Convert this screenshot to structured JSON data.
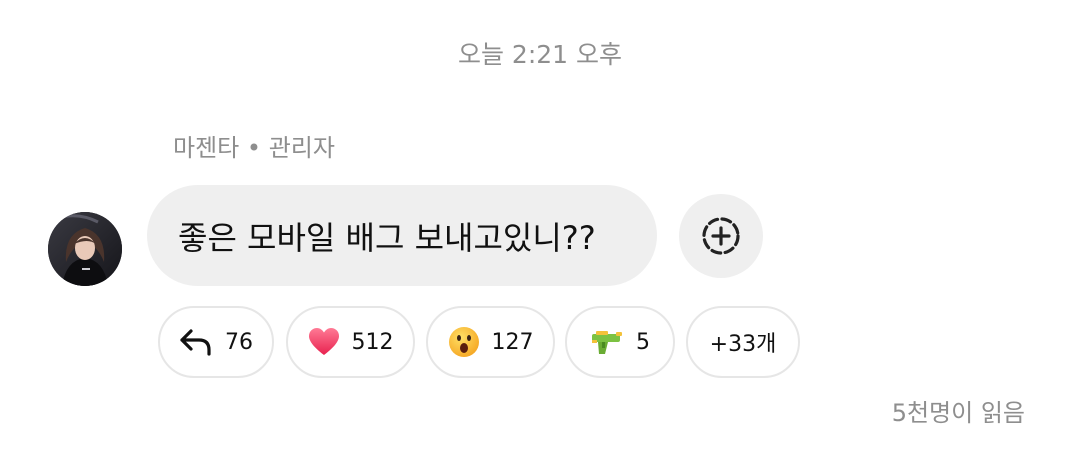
{
  "timestamp": "오늘 2:21 오후",
  "message": {
    "sender_name": "마젠타",
    "separator": "•",
    "sender_role": "관리자",
    "text": "좋은 모바일 배그 보내고있니??"
  },
  "reactions": [
    {
      "icon": "reply-arrow-icon",
      "count": "76"
    },
    {
      "icon": "heart-icon",
      "count": "512"
    },
    {
      "icon": "surprised-face-icon",
      "count": "127"
    },
    {
      "icon": "water-gun-icon",
      "count": "5"
    },
    {
      "icon": null,
      "count": "+33개"
    }
  ],
  "read_receipt": "5천명이 읽음",
  "colors": {
    "bubble_bg": "#efefef",
    "muted_text": "#8e8e8e",
    "heart": "#f0506e",
    "pill_border": "#e6e6e6"
  }
}
